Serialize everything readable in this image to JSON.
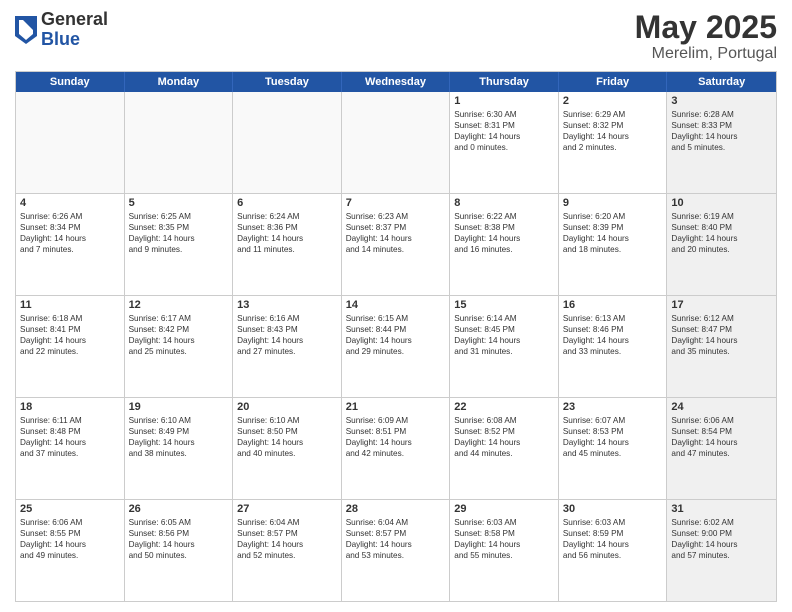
{
  "logo": {
    "general": "General",
    "blue": "Blue"
  },
  "title": {
    "month": "May 2025",
    "location": "Merelim, Portugal"
  },
  "header_days": [
    "Sunday",
    "Monday",
    "Tuesday",
    "Wednesday",
    "Thursday",
    "Friday",
    "Saturday"
  ],
  "weeks": [
    [
      {
        "day": "",
        "info": "",
        "empty": true
      },
      {
        "day": "",
        "info": "",
        "empty": true
      },
      {
        "day": "",
        "info": "",
        "empty": true
      },
      {
        "day": "",
        "info": "",
        "empty": true
      },
      {
        "day": "1",
        "info": "Sunrise: 6:30 AM\nSunset: 8:31 PM\nDaylight: 14 hours\nand 0 minutes."
      },
      {
        "day": "2",
        "info": "Sunrise: 6:29 AM\nSunset: 8:32 PM\nDaylight: 14 hours\nand 2 minutes."
      },
      {
        "day": "3",
        "info": "Sunrise: 6:28 AM\nSunset: 8:33 PM\nDaylight: 14 hours\nand 5 minutes.",
        "shaded": true
      }
    ],
    [
      {
        "day": "4",
        "info": "Sunrise: 6:26 AM\nSunset: 8:34 PM\nDaylight: 14 hours\nand 7 minutes."
      },
      {
        "day": "5",
        "info": "Sunrise: 6:25 AM\nSunset: 8:35 PM\nDaylight: 14 hours\nand 9 minutes."
      },
      {
        "day": "6",
        "info": "Sunrise: 6:24 AM\nSunset: 8:36 PM\nDaylight: 14 hours\nand 11 minutes."
      },
      {
        "day": "7",
        "info": "Sunrise: 6:23 AM\nSunset: 8:37 PM\nDaylight: 14 hours\nand 14 minutes."
      },
      {
        "day": "8",
        "info": "Sunrise: 6:22 AM\nSunset: 8:38 PM\nDaylight: 14 hours\nand 16 minutes."
      },
      {
        "day": "9",
        "info": "Sunrise: 6:20 AM\nSunset: 8:39 PM\nDaylight: 14 hours\nand 18 minutes."
      },
      {
        "day": "10",
        "info": "Sunrise: 6:19 AM\nSunset: 8:40 PM\nDaylight: 14 hours\nand 20 minutes.",
        "shaded": true
      }
    ],
    [
      {
        "day": "11",
        "info": "Sunrise: 6:18 AM\nSunset: 8:41 PM\nDaylight: 14 hours\nand 22 minutes."
      },
      {
        "day": "12",
        "info": "Sunrise: 6:17 AM\nSunset: 8:42 PM\nDaylight: 14 hours\nand 25 minutes."
      },
      {
        "day": "13",
        "info": "Sunrise: 6:16 AM\nSunset: 8:43 PM\nDaylight: 14 hours\nand 27 minutes."
      },
      {
        "day": "14",
        "info": "Sunrise: 6:15 AM\nSunset: 8:44 PM\nDaylight: 14 hours\nand 29 minutes."
      },
      {
        "day": "15",
        "info": "Sunrise: 6:14 AM\nSunset: 8:45 PM\nDaylight: 14 hours\nand 31 minutes."
      },
      {
        "day": "16",
        "info": "Sunrise: 6:13 AM\nSunset: 8:46 PM\nDaylight: 14 hours\nand 33 minutes."
      },
      {
        "day": "17",
        "info": "Sunrise: 6:12 AM\nSunset: 8:47 PM\nDaylight: 14 hours\nand 35 minutes.",
        "shaded": true
      }
    ],
    [
      {
        "day": "18",
        "info": "Sunrise: 6:11 AM\nSunset: 8:48 PM\nDaylight: 14 hours\nand 37 minutes."
      },
      {
        "day": "19",
        "info": "Sunrise: 6:10 AM\nSunset: 8:49 PM\nDaylight: 14 hours\nand 38 minutes."
      },
      {
        "day": "20",
        "info": "Sunrise: 6:10 AM\nSunset: 8:50 PM\nDaylight: 14 hours\nand 40 minutes."
      },
      {
        "day": "21",
        "info": "Sunrise: 6:09 AM\nSunset: 8:51 PM\nDaylight: 14 hours\nand 42 minutes."
      },
      {
        "day": "22",
        "info": "Sunrise: 6:08 AM\nSunset: 8:52 PM\nDaylight: 14 hours\nand 44 minutes."
      },
      {
        "day": "23",
        "info": "Sunrise: 6:07 AM\nSunset: 8:53 PM\nDaylight: 14 hours\nand 45 minutes."
      },
      {
        "day": "24",
        "info": "Sunrise: 6:06 AM\nSunset: 8:54 PM\nDaylight: 14 hours\nand 47 minutes.",
        "shaded": true
      }
    ],
    [
      {
        "day": "25",
        "info": "Sunrise: 6:06 AM\nSunset: 8:55 PM\nDaylight: 14 hours\nand 49 minutes."
      },
      {
        "day": "26",
        "info": "Sunrise: 6:05 AM\nSunset: 8:56 PM\nDaylight: 14 hours\nand 50 minutes."
      },
      {
        "day": "27",
        "info": "Sunrise: 6:04 AM\nSunset: 8:57 PM\nDaylight: 14 hours\nand 52 minutes."
      },
      {
        "day": "28",
        "info": "Sunrise: 6:04 AM\nSunset: 8:57 PM\nDaylight: 14 hours\nand 53 minutes."
      },
      {
        "day": "29",
        "info": "Sunrise: 6:03 AM\nSunset: 8:58 PM\nDaylight: 14 hours\nand 55 minutes."
      },
      {
        "day": "30",
        "info": "Sunrise: 6:03 AM\nSunset: 8:59 PM\nDaylight: 14 hours\nand 56 minutes."
      },
      {
        "day": "31",
        "info": "Sunrise: 6:02 AM\nSunset: 9:00 PM\nDaylight: 14 hours\nand 57 minutes.",
        "shaded": true
      }
    ]
  ]
}
